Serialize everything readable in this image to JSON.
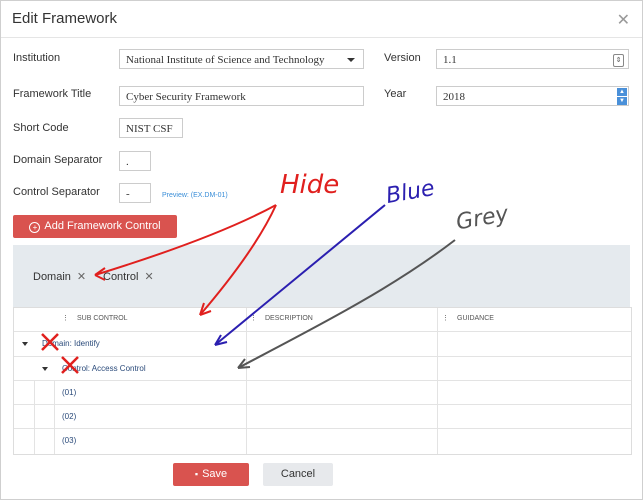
{
  "dialog": {
    "title": "Edit Framework"
  },
  "form": {
    "institution_label": "Institution",
    "institution_value": "National Institute of Science and Technology",
    "version_label": "Version",
    "version_value": "1.1",
    "title_label": "Framework Title",
    "title_value": "Cyber Security Framework",
    "year_label": "Year",
    "year_value": "2018",
    "shortcode_label": "Short Code",
    "shortcode_value": "NIST CSF",
    "domain_sep_label": "Domain Separator",
    "domain_sep_value": ".",
    "control_sep_label": "Control Separator",
    "control_sep_value": "-",
    "preview_text": "Preview: (EX.DM-01)"
  },
  "add_button": {
    "label": "Add Framework Control"
  },
  "group_chips": [
    {
      "label": "Domain"
    },
    {
      "label": "Control"
    }
  ],
  "grid": {
    "columns": [
      "SUB CONTROL",
      "DESCRIPTION",
      "GUIDANCE"
    ],
    "rows": [
      {
        "text": "Domain: Identify"
      },
      {
        "text": "Control: Access Control"
      },
      {
        "text": "(01)"
      },
      {
        "text": "(02)"
      },
      {
        "text": "(03)"
      }
    ]
  },
  "footer": {
    "save_label": "Save",
    "cancel_label": "Cancel"
  },
  "annotations": {
    "hide": "Hide",
    "blue": "Blue",
    "grey": "Grey",
    "colors": {
      "red": "#e0201e",
      "blue": "#2b1fb0",
      "grey": "#555555"
    }
  }
}
